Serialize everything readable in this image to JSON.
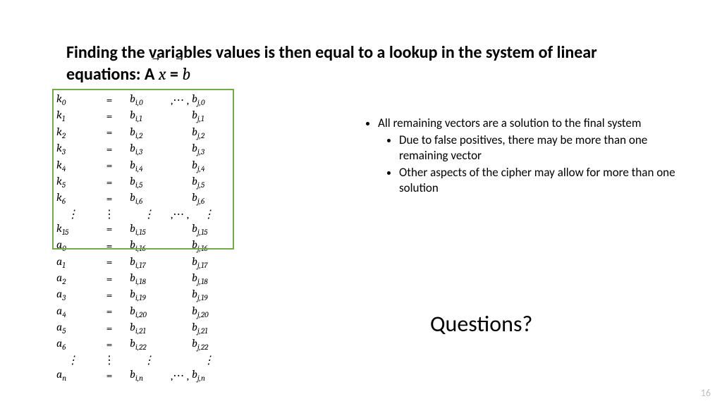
{
  "title": {
    "pre": "Finding the variables values is then equal to a lookup in the system of linear equations: A ",
    "xvec_arrow": "⃗",
    "xvec": "x",
    "mid": " = ",
    "bvec_arrow": "⃗",
    "bvec": "b"
  },
  "rows": [
    {
      "v": "k",
      "vs": "0",
      "b1": "b",
      "s1": "i,0",
      "dots": ",⋯ ,",
      "b2": "b",
      "s2": "j,0"
    },
    {
      "v": "k",
      "vs": "1",
      "b1": "b",
      "s1": "i,1",
      "dots": "",
      "b2": "b",
      "s2": "j,1"
    },
    {
      "v": "k",
      "vs": "2",
      "b1": "b",
      "s1": "i,2",
      "dots": "",
      "b2": "b",
      "s2": "j,2"
    },
    {
      "v": "k",
      "vs": "3",
      "b1": "b",
      "s1": "i,3",
      "dots": "",
      "b2": "b",
      "s2": "j,3"
    },
    {
      "v": "k",
      "vs": "4",
      "b1": "b",
      "s1": "i,4",
      "dots": "",
      "b2": "b",
      "s2": "j,4"
    },
    {
      "v": "k",
      "vs": "5",
      "b1": "b",
      "s1": "i,5",
      "dots": "",
      "b2": "b",
      "s2": "j,5"
    },
    {
      "v": "k",
      "vs": "6",
      "b1": "b",
      "s1": "i,6",
      "dots": "",
      "b2": "b",
      "s2": "j,6"
    },
    {
      "v": "⋮",
      "vs": "",
      "b1": "⋮",
      "s1": "",
      "dots": ",⋯ ,",
      "b2": "⋮",
      "s2": "",
      "eq": "⋮",
      "vd": true
    },
    {
      "v": "k",
      "vs": "15",
      "b1": "b",
      "s1": "i,15",
      "dots": "",
      "b2": "b",
      "s2": "j,15"
    },
    {
      "v": "a",
      "vs": "0",
      "b1": "b",
      "s1": "i,16",
      "dots": "",
      "b2": "b",
      "s2": "j,16"
    },
    {
      "v": "a",
      "vs": "1",
      "b1": "b",
      "s1": "i,17",
      "dots": "",
      "b2": "b",
      "s2": "j,17"
    },
    {
      "v": "a",
      "vs": "2",
      "b1": "b",
      "s1": "i,18",
      "dots": "",
      "b2": "b",
      "s2": "j,18"
    },
    {
      "v": "a",
      "vs": "3",
      "b1": "b",
      "s1": "i,19",
      "dots": "",
      "b2": "b",
      "s2": "j,19"
    },
    {
      "v": "a",
      "vs": "4",
      "b1": "b",
      "s1": "i,20",
      "dots": "",
      "b2": "b",
      "s2": "j,20"
    },
    {
      "v": "a",
      "vs": "5",
      "b1": "b",
      "s1": "i,21",
      "dots": "",
      "b2": "b",
      "s2": "j,21"
    },
    {
      "v": "a",
      "vs": "6",
      "b1": "b",
      "s1": "i,22",
      "dots": "",
      "b2": "b",
      "s2": "j,22"
    },
    {
      "v": "⋮",
      "vs": "",
      "b1": "⋮",
      "s1": "",
      "dots": "",
      "b2": "⋮",
      "s2": "",
      "eq": "⋮",
      "vd": true
    },
    {
      "v": "a",
      "vs": "n",
      "b1": "b",
      "s1": "i,n",
      "dots": ",⋯ ,",
      "b2": "b",
      "s2": "j,n"
    }
  ],
  "eq_default": "=",
  "bullets": {
    "l0": "All remaining vectors are a solution to the final system",
    "l1": "Due to false positives, there may be more than one remaining vector",
    "l2": "Other aspects of the cipher may allow for more than one solution"
  },
  "questions": "Questions?",
  "page_number": "16"
}
